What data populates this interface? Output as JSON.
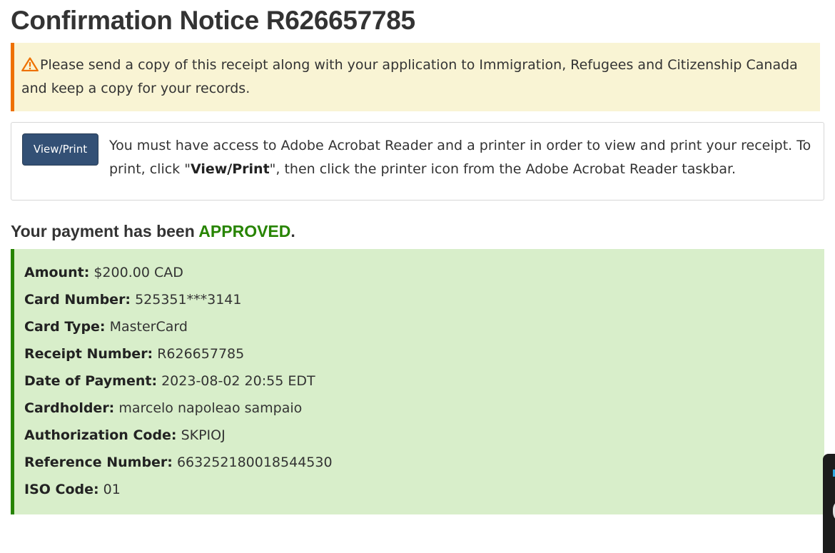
{
  "page": {
    "title": "Confirmation Notice R626657785"
  },
  "warning": {
    "icon": "warning-triangle-icon",
    "text": "Please send a copy of this receipt along with your application to Immigration, Refugees and Citizenship Canada and keep a copy for your records."
  },
  "print_panel": {
    "button_label": "View/Print",
    "text_before": "You must have access to Adobe Acrobat Reader and a printer in order to view and print your receipt. To print, click \"",
    "text_bold": "View/Print",
    "text_after": "\", then click the printer icon from the Adobe Acrobat Reader taskbar."
  },
  "payment_status": {
    "prefix": "Your payment has been ",
    "status": "APPROVED",
    "suffix": ".",
    "status_color": "#278400"
  },
  "details": [
    {
      "label": "Amount:",
      "value": "$200.00 CAD"
    },
    {
      "label": "Card Number:",
      "value": "525351***3141"
    },
    {
      "label": "Card Type:",
      "value": "MasterCard"
    },
    {
      "label": "Receipt Number:",
      "value": "R626657785"
    },
    {
      "label": "Date of Payment:",
      "value": "2023-08-02 20:55 EDT"
    },
    {
      "label": "Cardholder:",
      "value": "marcelo napoleao sampaio"
    },
    {
      "label": "Authorization Code:",
      "value": "SKPIOJ"
    },
    {
      "label": "Reference Number:",
      "value": "663252180018544530"
    },
    {
      "label": "ISO Code:",
      "value": "01"
    }
  ],
  "colors": {
    "warning_bg": "#f9f4d4",
    "warning_border": "#ee7100",
    "success_bg": "#d8eeca",
    "success_border": "#278400",
    "button_bg": "#335075"
  }
}
